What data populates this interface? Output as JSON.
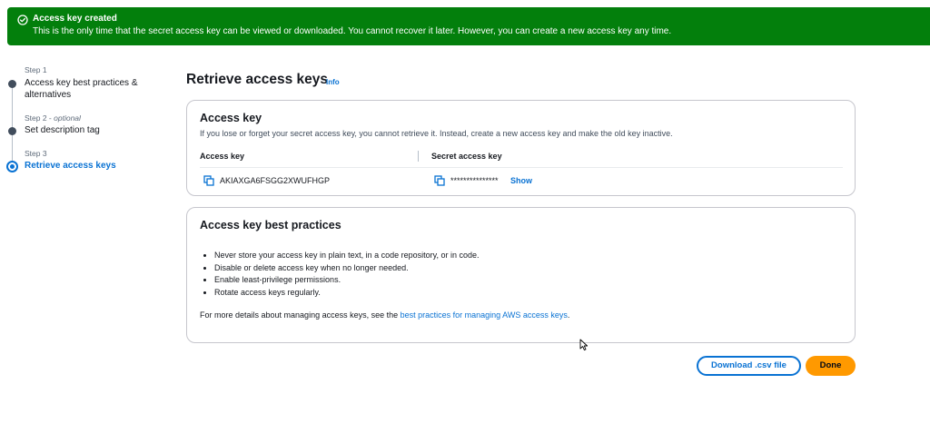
{
  "banner": {
    "title": "Access key created",
    "message": "This is the only time that the secret access key can be viewed or downloaded. You cannot recover it later. However, you can create a new access key any time.",
    "color": "#037f0c",
    "icon": "check-circle-icon"
  },
  "steps": [
    {
      "number": "Step 1",
      "optional": "",
      "label": "Access key best practices & alternatives",
      "state": "complete"
    },
    {
      "number": "Step 2 - ",
      "optional": "optional",
      "label": "Set description tag",
      "state": "complete"
    },
    {
      "number": "Step 3",
      "optional": "",
      "label": "Retrieve access keys",
      "state": "active"
    }
  ],
  "page": {
    "title": "Retrieve access keys",
    "info_label": "Info"
  },
  "access_key_card": {
    "title": "Access key",
    "description": "If you lose or forget your secret access key, you cannot retrieve it. Instead, create a new access key and make the old key inactive.",
    "columns": [
      "Access key",
      "Secret access key"
    ],
    "access_key_value": "AKIAXGA6FSGG2XWUFHGP",
    "secret_value": "***************",
    "show_label": "Show",
    "copy_icon": "copy-icon"
  },
  "best_practices_card": {
    "title": "Access key best practices",
    "bullets": [
      "Never store your access key in plain text, in a code repository, or in code.",
      "Disable or delete access key when no longer needed.",
      "Enable least-privilege permissions.",
      "Rotate access keys regularly."
    ],
    "more_prefix": "For more details about managing access keys, see the ",
    "more_link": "best practices for managing AWS access keys",
    "more_suffix": "."
  },
  "actions": {
    "download_label": "Download .csv file",
    "done_label": "Done"
  },
  "colors": {
    "accent": "#0972d3",
    "primary_button": "#ff9900",
    "success": "#037f0c"
  }
}
